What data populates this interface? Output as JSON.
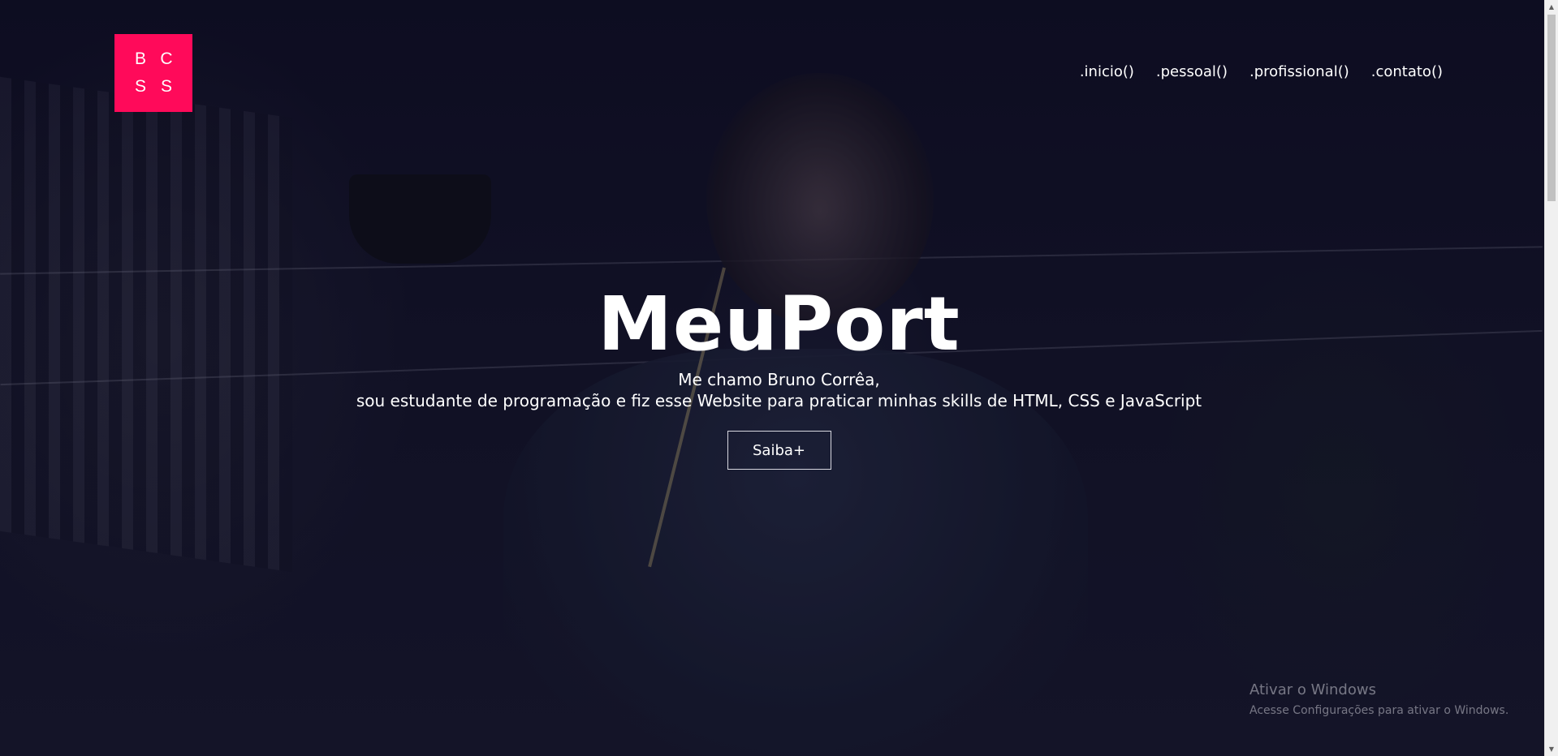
{
  "logo": {
    "letters": [
      "B",
      "C",
      "S",
      "S"
    ],
    "color": "#ff0a5a"
  },
  "nav": {
    "items": [
      {
        "label": ".inicio()"
      },
      {
        "label": ".pessoal()"
      },
      {
        "label": ".profissional()"
      },
      {
        "label": ".contato()"
      }
    ]
  },
  "hero": {
    "title": "MeuPort",
    "intro_line1": "Me chamo Bruno Corrêa,",
    "intro_line2": "sou estudante de programação e fiz esse Website para praticar minhas skills de HTML, CSS e JavaScript",
    "button_label": "Saiba+"
  },
  "watermark": {
    "title": "Ativar o Windows",
    "subtitle": "Acesse Configurações para ativar o Windows."
  },
  "scrollbar": {
    "up_icon": "chevron-up-icon",
    "down_icon": "chevron-down-icon"
  }
}
